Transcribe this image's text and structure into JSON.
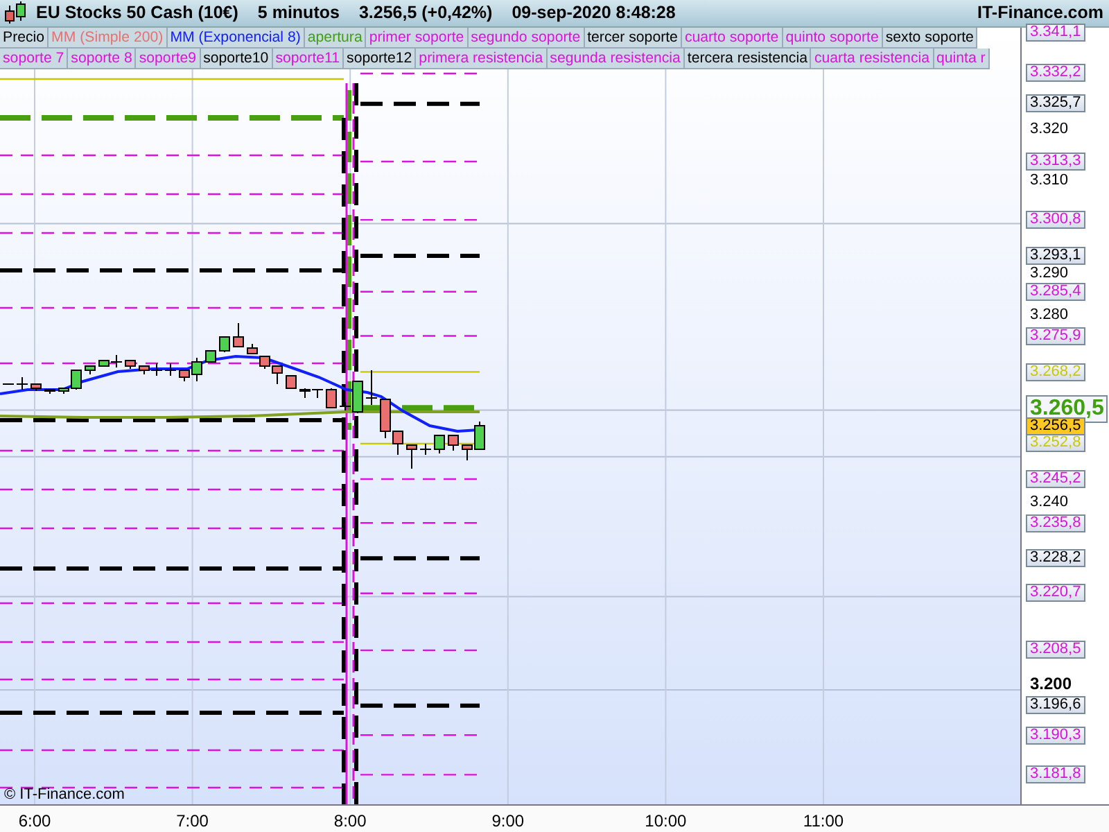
{
  "header": {
    "title": "EU Stocks 50 Cash (10€)",
    "interval": "5 minutos",
    "quote": "3.256,5 (+0,42%)",
    "datetime": "09-sep-2020 8:48:28",
    "brand": "IT-Finance.com"
  },
  "legend_rows": [
    {
      "items": [
        {
          "label": "Precio",
          "color": "#000000"
        },
        {
          "label": "MM (Simple 200)",
          "color": "#e87070"
        },
        {
          "label": "MM (Exponencial 8)",
          "color": "#1020ff"
        },
        {
          "label": "apertura",
          "color": "#40a010"
        },
        {
          "label": "primer soporte",
          "color": "#e010e0"
        },
        {
          "label": "segundo soporte",
          "color": "#e010e0"
        },
        {
          "label": "tercer soporte",
          "color": "#000000"
        },
        {
          "label": "cuarto soporte",
          "color": "#e010e0"
        },
        {
          "label": "quinto soporte",
          "color": "#e010e0"
        },
        {
          "label": "sexto soporte",
          "color": "#000000"
        }
      ]
    },
    {
      "items": [
        {
          "label": "soporte 7",
          "color": "#e010e0"
        },
        {
          "label": "soporte 8",
          "color": "#e010e0"
        },
        {
          "label": "soporte9",
          "color": "#e010e0"
        },
        {
          "label": "soporte10",
          "color": "#000000"
        },
        {
          "label": "soporte11",
          "color": "#e010e0"
        },
        {
          "label": "soporte12",
          "color": "#000000"
        },
        {
          "label": "primera resistencia",
          "color": "#e010e0"
        },
        {
          "label": "segunda resistencia",
          "color": "#e010e0"
        },
        {
          "label": "tercera resistencia",
          "color": "#000000"
        },
        {
          "label": "cuarta resistencia",
          "color": "#e010e0"
        },
        {
          "label": "quinta r",
          "color": "#e010e0"
        }
      ]
    }
  ],
  "price_axis": {
    "ticks": [
      {
        "label": "3.320",
        "bold": false
      },
      {
        "label": "3.310",
        "bold": false
      },
      {
        "label": "3.290",
        "bold": false
      },
      {
        "label": "3.280",
        "bold": false
      },
      {
        "label": "3.240",
        "bold": false
      },
      {
        "label": "3.200",
        "bold": true
      }
    ],
    "tags": [
      {
        "label": "3.341,1",
        "kind": "level",
        "color": "#e010e0"
      },
      {
        "label": "3.332,2",
        "kind": "level",
        "color": "#e010e0"
      },
      {
        "label": "3.325,7",
        "kind": "level",
        "color": "#000000"
      },
      {
        "label": "3.313,3",
        "kind": "level",
        "color": "#e010e0"
      },
      {
        "label": "3.300,8",
        "kind": "level",
        "color": "#e010e0"
      },
      {
        "label": "3.293,1",
        "kind": "level",
        "color": "#000000"
      },
      {
        "label": "3.285,4",
        "kind": "level",
        "color": "#e010e0"
      },
      {
        "label": "3.275,9",
        "kind": "level",
        "color": "#e010e0"
      },
      {
        "label": "3.268,2",
        "kind": "level",
        "color": "#c8c800"
      },
      {
        "label": "3.260,5",
        "kind": "open",
        "color": "#40a010"
      },
      {
        "label": "3.256,5",
        "kind": "price",
        "color": "#ffc820"
      },
      {
        "label": "3.252,8",
        "kind": "level",
        "color": "#c8c800"
      },
      {
        "label": "3.245,2",
        "kind": "level",
        "color": "#e010e0"
      },
      {
        "label": "3.235,8",
        "kind": "level",
        "color": "#e010e0"
      },
      {
        "label": "3.228,2",
        "kind": "level",
        "color": "#000000"
      },
      {
        "label": "3.220,7",
        "kind": "level",
        "color": "#e010e0"
      },
      {
        "label": "3.208,5",
        "kind": "level",
        "color": "#e010e0"
      },
      {
        "label": "3.196,6",
        "kind": "level",
        "color": "#000000"
      },
      {
        "label": "3.190,3",
        "kind": "level",
        "color": "#e010e0"
      },
      {
        "label": "3.181,8",
        "kind": "level",
        "color": "#e010e0"
      }
    ]
  },
  "copyright": "© IT-Finance.com",
  "time_axis": [
    "6:00",
    "7:00",
    "8:00",
    "9:00",
    "10:00",
    "11:00"
  ]
}
